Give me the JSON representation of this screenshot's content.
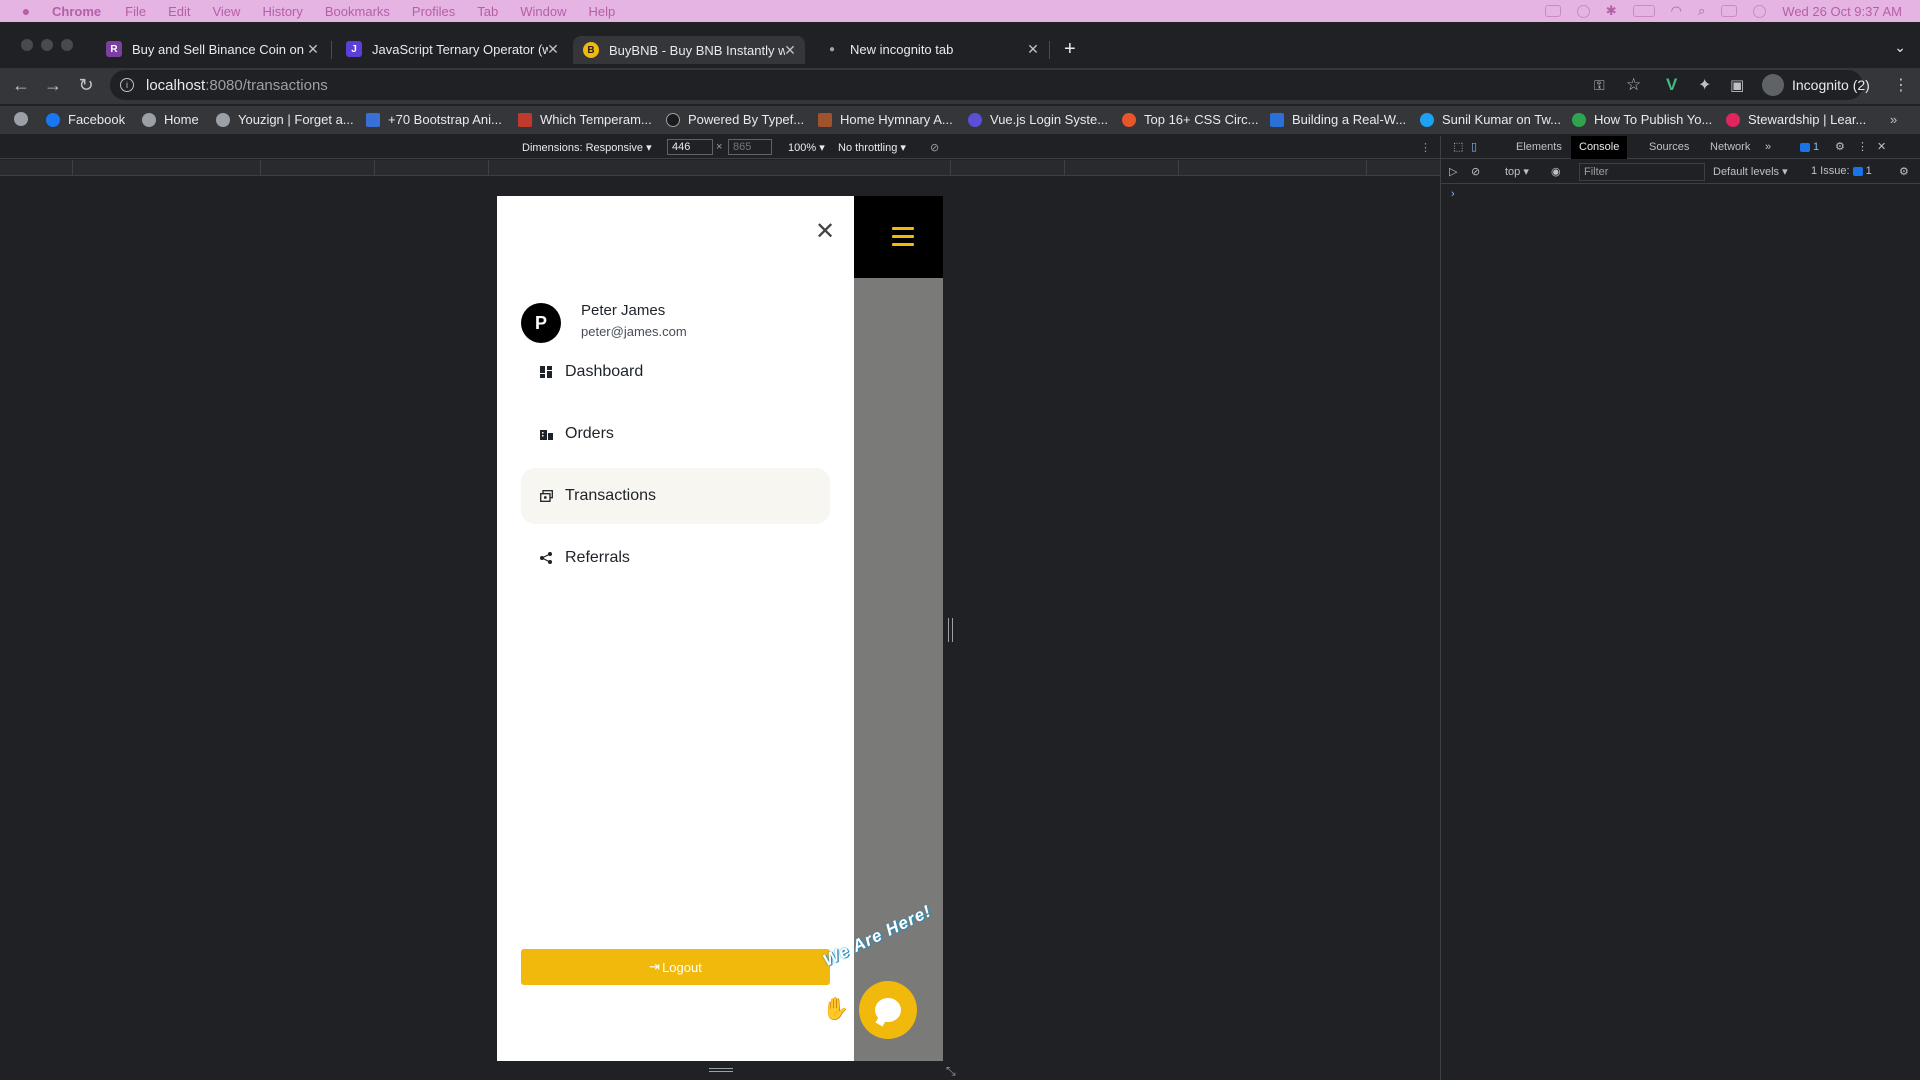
{
  "menubar": {
    "app": "Chrome",
    "items": [
      "File",
      "Edit",
      "View",
      "History",
      "Bookmarks",
      "Profiles",
      "Tab",
      "Window",
      "Help"
    ],
    "datetime": "Wed 26 Oct  9:37 AM"
  },
  "tabs": [
    {
      "title": "Buy and Sell Binance Coin on P",
      "color": "#7b3fa0",
      "glyph": "R"
    },
    {
      "title": "JavaScript Ternary Operator (w",
      "color": "#5b3fd6",
      "glyph": "J"
    },
    {
      "title": "BuyBNB - Buy BNB Instantly w",
      "color": "#f0b90b",
      "glyph": "B"
    },
    {
      "title": "New incognito tab",
      "color": "#5f6368",
      "glyph": "●"
    }
  ],
  "address": {
    "host": "localhost",
    "path": ":8080/transactions"
  },
  "profile": {
    "label": "Incognito (2)"
  },
  "bookmarks": [
    {
      "label": "Facebook",
      "color": "#1877f2"
    },
    {
      "label": "Home",
      "color": "#9aa0a6"
    },
    {
      "label": "Youzign | Forget a...",
      "color": "#9aa0a6"
    },
    {
      "label": "+70 Bootstrap Ani...",
      "color": "#3a6fd8"
    },
    {
      "label": "Which Temperam...",
      "color": "#c0392b"
    },
    {
      "label": "Powered By Typef...",
      "color": "#1b1b1b"
    },
    {
      "label": "Home Hymnary A...",
      "color": "#a0522d"
    },
    {
      "label": "Vue.js Login Syste...",
      "color": "#5b4fd6"
    },
    {
      "label": "Top 16+ CSS Circ...",
      "color": "#e8552a"
    },
    {
      "label": "Building a Real-W...",
      "color": "#2b6fd9"
    },
    {
      "label": "Sunil Kumar on Tw...",
      "color": "#1da1f2"
    },
    {
      "label": "How To Publish Yo...",
      "color": "#2ea44f"
    },
    {
      "label": "Stewardship | Lear...",
      "color": "#e0245e"
    }
  ],
  "devicebar": {
    "dimensions_label": "Dimensions: Responsive",
    "width": "446",
    "height_placeholder": "865",
    "zoom": "100%",
    "throttle": "No throttling"
  },
  "app": {
    "user": {
      "initial": "P",
      "name": "Peter James",
      "email": "peter@james.com"
    },
    "nav": [
      {
        "label": "Dashboard",
        "icon": "dashboard-icon",
        "active": false
      },
      {
        "label": "Orders",
        "icon": "orders-icon",
        "active": false
      },
      {
        "label": "Transactions",
        "icon": "transactions-icon",
        "active": true
      },
      {
        "label": "Referrals",
        "icon": "share-icon",
        "active": false
      }
    ],
    "logout_label": "Logout",
    "chat_label": "We Are Here!",
    "accent": "#f0b90b"
  },
  "devtools": {
    "tabs": [
      "Elements",
      "Console",
      "Sources",
      "Network"
    ],
    "active_tab": "Console",
    "issues_badge": "1",
    "context": "top",
    "filter_placeholder": "Filter",
    "levels": "Default levels",
    "issues_label": "1 Issue:",
    "issues_count": "1"
  }
}
